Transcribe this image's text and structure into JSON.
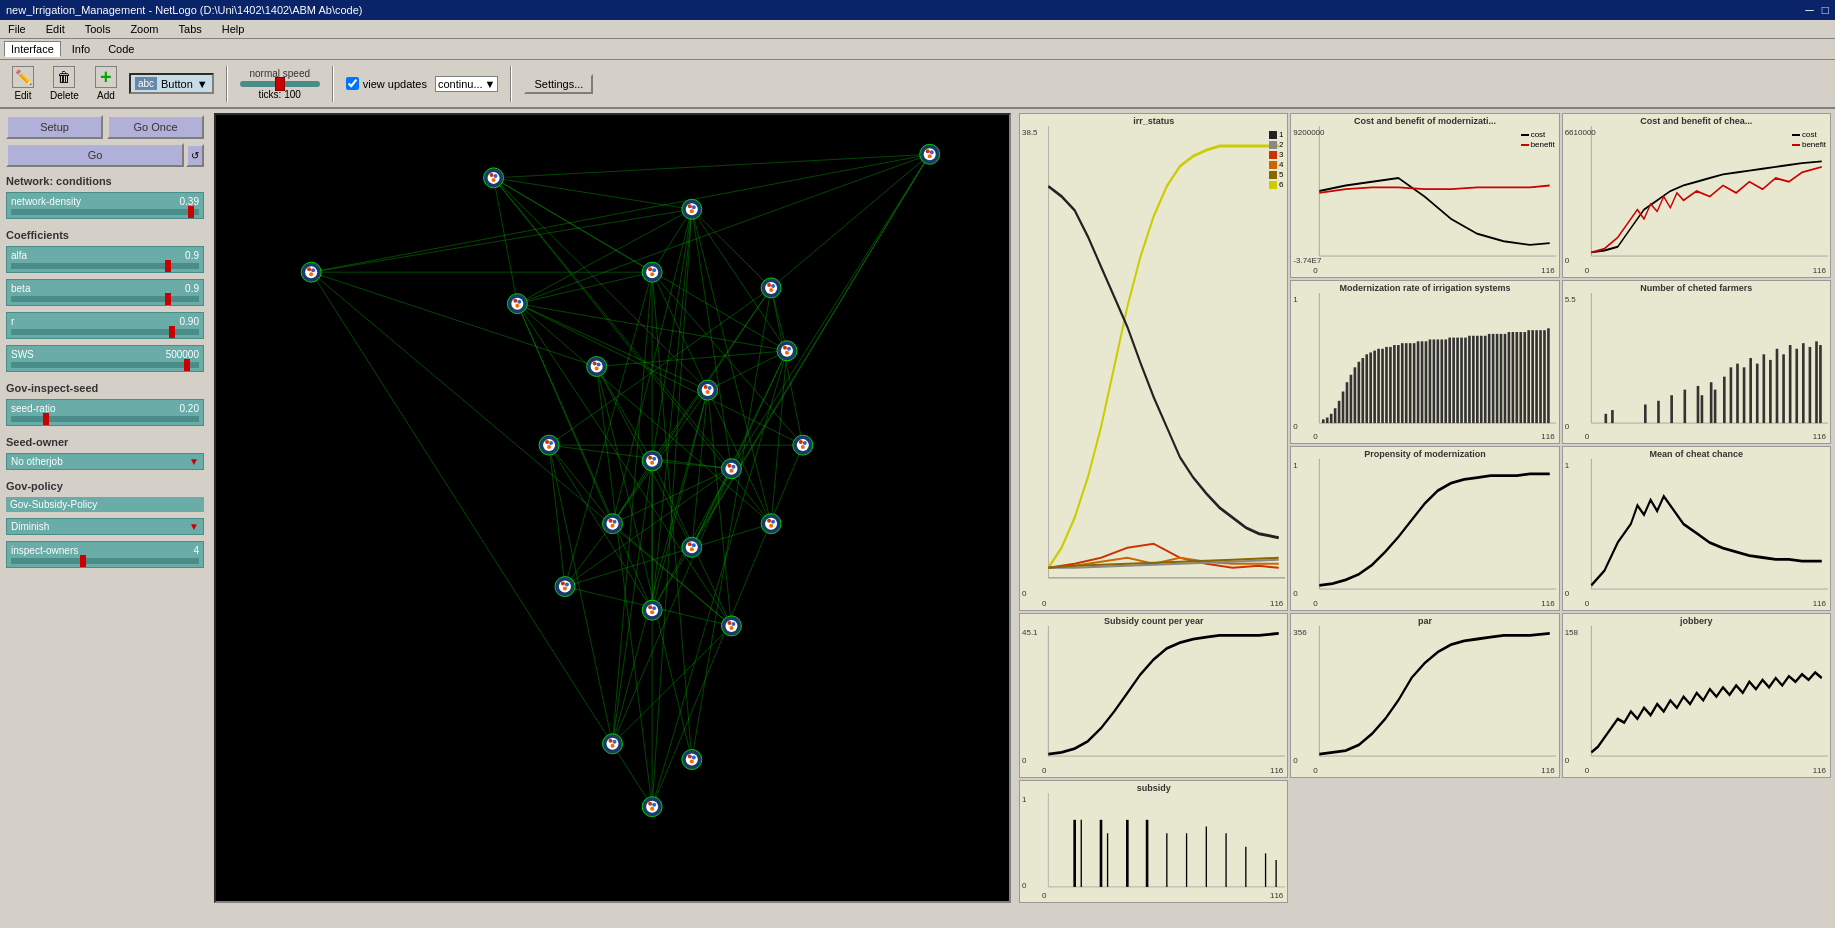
{
  "titleBar": {
    "title": "new_Irrigation_Management - NetLogo (D:\\Uni\\1402\\1402\\ABM Ab\\code)",
    "minBtn": "─",
    "maxBtn": "□"
  },
  "menuBar": {
    "items": [
      "File",
      "Edit",
      "Tools",
      "Zoom",
      "Tabs",
      "Help"
    ]
  },
  "tabs": [
    {
      "label": "Interface",
      "active": true
    },
    {
      "label": "Info",
      "active": false
    },
    {
      "label": "Code",
      "active": false
    }
  ],
  "toolbar": {
    "edit_label": "Edit",
    "delete_label": "Delete",
    "add_label": "Add",
    "button_type": "Button",
    "speed_label": "normal speed",
    "ticks_label": "ticks: 100",
    "view_updates_label": "view updates",
    "continuo_label": "continu...",
    "settings_label": "Settings..."
  },
  "controls": {
    "setup_label": "Setup",
    "go_once_label": "Go Once",
    "go_label": "Go"
  },
  "sections": {
    "network_conditions": "Network: conditions",
    "coefficients": "Coefficients",
    "gov_inspect_seed": "Gov-inspect-seed",
    "seed_owner": "Seed-owner",
    "gov_policy": "Gov-policy"
  },
  "sliders": {
    "network_density": {
      "name": "network-density",
      "value": "0.39"
    },
    "alfa": {
      "name": "alfa",
      "value": "0.9"
    },
    "beta": {
      "name": "beta",
      "value": "0.9"
    },
    "r": {
      "name": "r",
      "value": "0.90"
    },
    "sws": {
      "name": "SWS",
      "value": "500000"
    },
    "seed_ratio": {
      "name": "seed-ratio",
      "value": "0.20"
    },
    "inspect_owners": {
      "name": "inspect-owners",
      "value": "4"
    }
  },
  "dropdowns": {
    "seed_owner_val": "No otherjob",
    "gov_subsidy_policy_label": "Gov-Subsidy-Policy",
    "gov_subsidy_policy_val": "Diminish"
  },
  "charts": [
    {
      "id": "cost_benefit_mod",
      "title": "Cost and benefit of modernizati...",
      "yMax": "9200000",
      "yMin": "-3.74E7",
      "xMax": "116",
      "xMin": "0",
      "legend": [
        {
          "label": "cost",
          "color": "#000000"
        },
        {
          "label": "benefit",
          "color": "#cc0000"
        }
      ]
    },
    {
      "id": "cost_benefit_chea",
      "title": "Cost and benefit of chea...",
      "yMax": "6610000",
      "yMin": "0",
      "xMax": "116",
      "xMin": "0",
      "legend": [
        {
          "label": "cost",
          "color": "#000000"
        },
        {
          "label": "benefit",
          "color": "#cc0000"
        }
      ]
    },
    {
      "id": "irr_status",
      "title": "irr_status",
      "yMax": "38.5",
      "yMin": "0",
      "xMax": "116",
      "xMin": "0",
      "legend": [
        {
          "label": "1",
          "color": "#222222"
        },
        {
          "label": "2",
          "color": "#888888"
        },
        {
          "label": "3",
          "color": "#cc3300"
        },
        {
          "label": "4",
          "color": "#cc6600"
        },
        {
          "label": "5",
          "color": "#886600"
        },
        {
          "label": "6",
          "color": "#cccc00"
        }
      ]
    },
    {
      "id": "modernization_rate",
      "title": "Modernization rate of irrigation systems",
      "yMax": "1",
      "yMin": "0",
      "xMax": "116",
      "xMin": "0"
    },
    {
      "id": "number_cheted",
      "title": "Number of cheted farmers",
      "yMax": "5.5",
      "yMin": "0",
      "xMax": "116",
      "xMin": "0"
    },
    {
      "id": "propensity_mod",
      "title": "Propensity of modernization",
      "yMax": "1",
      "yMin": "0",
      "xMax": "116",
      "xMin": "0"
    },
    {
      "id": "mean_cheat_chance",
      "title": "Mean of cheat chance",
      "yMax": "1",
      "yMin": "0",
      "xMax": "116",
      "xMin": "0"
    },
    {
      "id": "subsidy_count",
      "title": "Subsidy count per year",
      "yMax": "45.1",
      "yMin": "0",
      "xMax": "116",
      "xMin": "0"
    },
    {
      "id": "par",
      "title": "par",
      "yMax": "356",
      "yMin": "0",
      "xMax": "116",
      "xMin": "0"
    },
    {
      "id": "jobbery",
      "title": "jobbery",
      "yMax": "158",
      "yMin": "0",
      "xMax": "116",
      "xMin": "0"
    },
    {
      "id": "subsidy",
      "title": "subsidy",
      "yMax": "1",
      "yMin": "0",
      "xMax": "116",
      "xMin": "0"
    }
  ]
}
